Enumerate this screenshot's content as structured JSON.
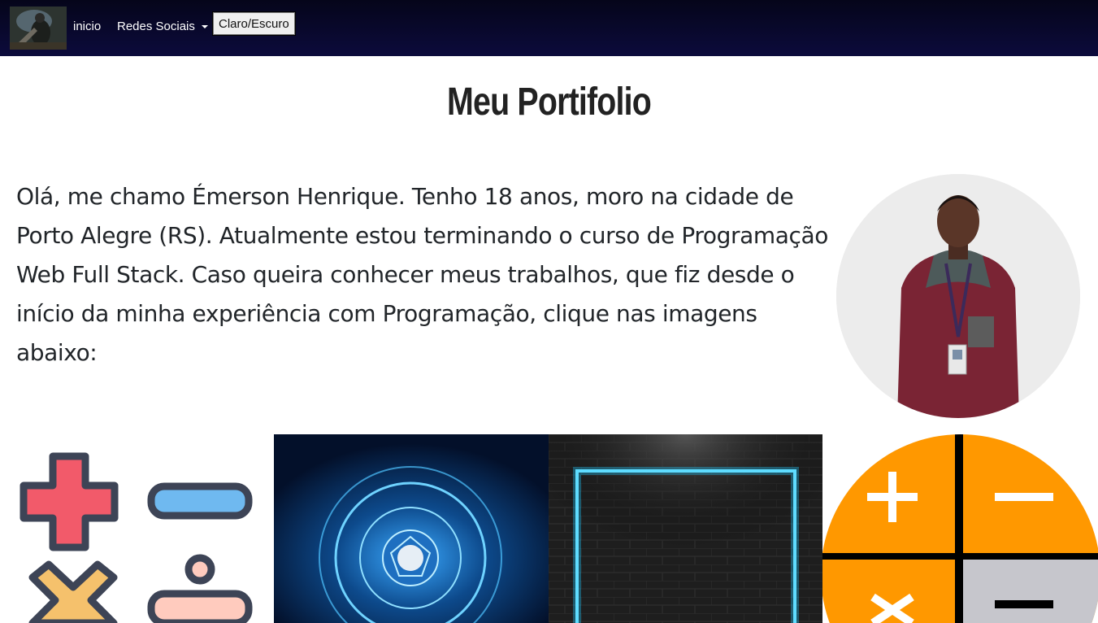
{
  "nav": {
    "home_label": "inicio",
    "social_label": "Redes Sociais",
    "theme_toggle_label": "Claro/Escuro"
  },
  "main": {
    "title": "Meu Portifolio",
    "intro_text": "Olá, me chamo Émerson Henrique. Tenho 18 anos, moro na cidade de Porto Alegre (RS). Atualmente estou terminando o curso de Programação Web Full Stack. Caso queira conhecer meus trabalhos, que fiz desde o início da minha experiência com Programação, clique nas imagens abaixo:"
  },
  "colors": {
    "navbar": "#0c0b3c",
    "calc_orange": "#ff9800",
    "neon_blue": "#1ec8ff",
    "plus_red": "#f25a6a",
    "minus_blue": "#6fb9f0"
  },
  "icons": {
    "logo": "profile-logo-icon",
    "caret": "chevron-down-icon"
  }
}
